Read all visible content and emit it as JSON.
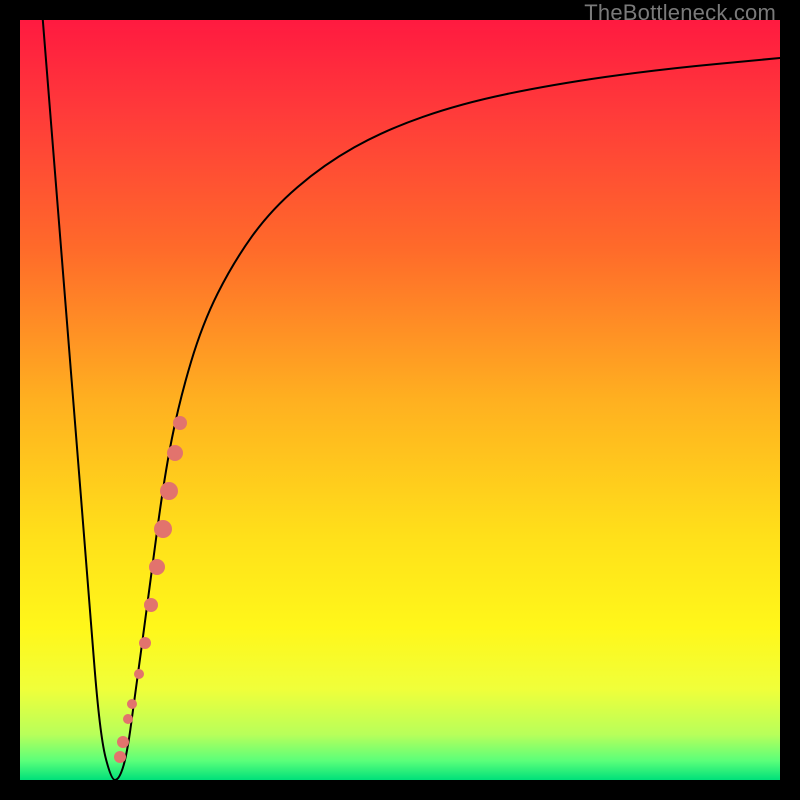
{
  "watermark": "TheBottleneck.com",
  "colors": {
    "frame": "#000000",
    "watermark": "#7a7a7a",
    "curve": "#000000",
    "dots": "#e2736d",
    "gradient_stops": [
      {
        "offset": 0.0,
        "color": "#ff1a40"
      },
      {
        "offset": 0.12,
        "color": "#ff3a3a"
      },
      {
        "offset": 0.3,
        "color": "#ff6a2a"
      },
      {
        "offset": 0.5,
        "color": "#ffb020"
      },
      {
        "offset": 0.68,
        "color": "#ffe01a"
      },
      {
        "offset": 0.8,
        "color": "#fff71a"
      },
      {
        "offset": 0.88,
        "color": "#f0ff3a"
      },
      {
        "offset": 0.94,
        "color": "#b8ff5a"
      },
      {
        "offset": 0.975,
        "color": "#5aff7a"
      },
      {
        "offset": 1.0,
        "color": "#00e07a"
      }
    ]
  },
  "chart_data": {
    "type": "line",
    "title": "",
    "xlabel": "",
    "ylabel": "",
    "xlim": [
      0,
      100
    ],
    "ylim": [
      0,
      100
    ],
    "series": [
      {
        "name": "bottleneck-curve",
        "x": [
          3,
          5,
          7,
          9,
          10.5,
          12,
          13,
          14,
          15,
          17,
          19,
          21,
          24,
          28,
          33,
          40,
          48,
          58,
          70,
          84,
          100
        ],
        "y": [
          100,
          75,
          50,
          25,
          6,
          0,
          0,
          3,
          10,
          25,
          40,
          50,
          60,
          68,
          75,
          81,
          85.5,
          89,
          91.5,
          93.5,
          95
        ]
      }
    ],
    "scatter": {
      "name": "highlight-dots",
      "points": [
        {
          "x": 13.2,
          "y": 3,
          "r": 6
        },
        {
          "x": 13.6,
          "y": 5,
          "r": 6
        },
        {
          "x": 14.2,
          "y": 8,
          "r": 5
        },
        {
          "x": 14.8,
          "y": 10,
          "r": 5
        },
        {
          "x": 15.6,
          "y": 14,
          "r": 5
        },
        {
          "x": 16.4,
          "y": 18,
          "r": 6
        },
        {
          "x": 17.2,
          "y": 23,
          "r": 7
        },
        {
          "x": 18.0,
          "y": 28,
          "r": 8
        },
        {
          "x": 18.8,
          "y": 33,
          "r": 9
        },
        {
          "x": 19.6,
          "y": 38,
          "r": 9
        },
        {
          "x": 20.4,
          "y": 43,
          "r": 8
        },
        {
          "x": 21.0,
          "y": 47,
          "r": 7
        }
      ]
    }
  }
}
